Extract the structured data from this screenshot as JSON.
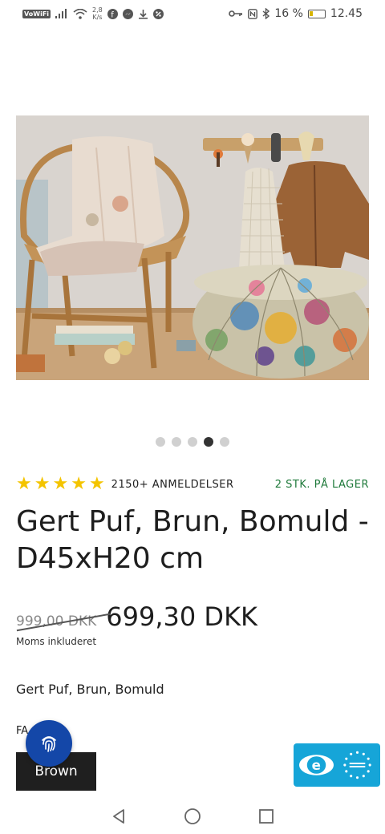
{
  "status_bar": {
    "vowifi": "VoWiFi",
    "speed_value": "2,8",
    "speed_unit": "K/s",
    "battery_percent": "16 %",
    "time": "12.45",
    "icons": [
      "signal-icon",
      "wifi-icon",
      "facebook-icon",
      "messenger-icon",
      "download-icon",
      "app-icon",
      "key-icon",
      "nfc-icon",
      "bluetooth-icon",
      "battery-icon"
    ]
  },
  "carousel": {
    "total": 5,
    "active_index": 3
  },
  "product": {
    "rating_stars": 5,
    "reviews": "2150+ ANMELDELSER",
    "stock": "2 STK. PÅ LAGER",
    "title": "Gert Puf, Brun, Bomuld - D45xH20 cm",
    "old_price": "999,00 DKK",
    "price": "699,30 DKK",
    "vat_note": "Moms inkluderet",
    "subtitle": "Gert Puf, Brun, Bomuld",
    "attribute_label": "FA",
    "color_option": "Brown"
  },
  "colors": {
    "star": "#f4c400",
    "stock": "#1f7a3b",
    "fingerprint_button": "#1447a8",
    "badge": "#16a5d8"
  }
}
